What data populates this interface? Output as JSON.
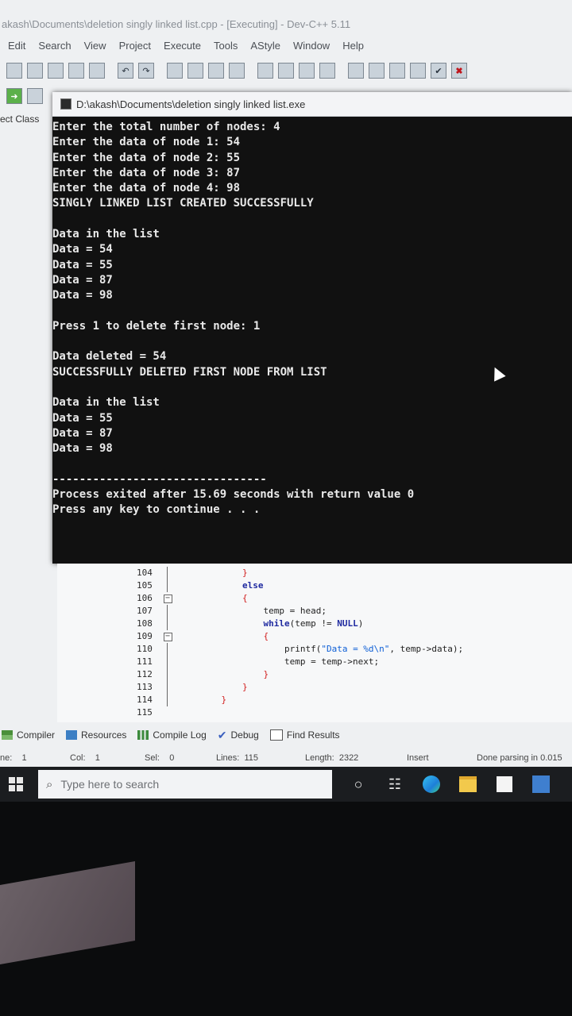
{
  "window": {
    "title": "akash\\Documents\\deletion singly linked list.cpp - [Executing] - Dev-C++ 5.11"
  },
  "menu": [
    "Edit",
    "Search",
    "View",
    "Project",
    "Execute",
    "Tools",
    "AStyle",
    "Window",
    "Help"
  ],
  "left_panel": {
    "tabs_label": "ect  Class"
  },
  "console": {
    "title": "D:\\akash\\Documents\\deletion singly linked list.exe",
    "lines": [
      "Enter the total number of nodes: 4",
      "Enter the data of node 1: 54",
      "Enter the data of node 2: 55",
      "Enter the data of node 3: 87",
      "Enter the data of node 4: 98",
      "SINGLY LINKED LIST CREATED SUCCESSFULLY",
      "",
      "Data in the list",
      "Data = 54",
      "Data = 55",
      "Data = 87",
      "Data = 98",
      "",
      "Press 1 to delete first node: 1",
      "",
      "Data deleted = 54",
      "SUCCESSFULLY DELETED FIRST NODE FROM LIST",
      "",
      "Data in the list",
      "Data = 55",
      "Data = 87",
      "Data = 98",
      "",
      "--------------------------------",
      "Process exited after 15.69 seconds with return value 0",
      "Press any key to continue . . ."
    ]
  },
  "editor": {
    "lines": [
      {
        "num": "104",
        "code": "        }"
      },
      {
        "num": "105",
        "code": "        else"
      },
      {
        "num": "106",
        "code": "        {"
      },
      {
        "num": "107",
        "code": "            temp = head;"
      },
      {
        "num": "108",
        "code": "            while(temp != NULL)"
      },
      {
        "num": "109",
        "code": "            {"
      },
      {
        "num": "110",
        "code": "                printf(\"Data = %d\\n\", temp->data);"
      },
      {
        "num": "111",
        "code": "                temp = temp->next;"
      },
      {
        "num": "112",
        "code": "            }"
      },
      {
        "num": "113",
        "code": "        }"
      },
      {
        "num": "114",
        "code": "    }"
      },
      {
        "num": "115",
        "code": ""
      }
    ]
  },
  "bottom_tabs": [
    "Compiler",
    "Resources",
    "Compile Log",
    "Debug",
    "Find Results"
  ],
  "status": {
    "line_label": "ne:",
    "line_value": "1",
    "col_label": "Col:",
    "col_value": "1",
    "sel_label": "Sel:",
    "sel_value": "0",
    "lines_label": "Lines:",
    "lines_value": "115",
    "length_label": "Length:",
    "length_value": "2322",
    "mode": "Insert",
    "message": "Done parsing in 0.015"
  },
  "taskbar": {
    "search_placeholder": "Type here to search"
  }
}
